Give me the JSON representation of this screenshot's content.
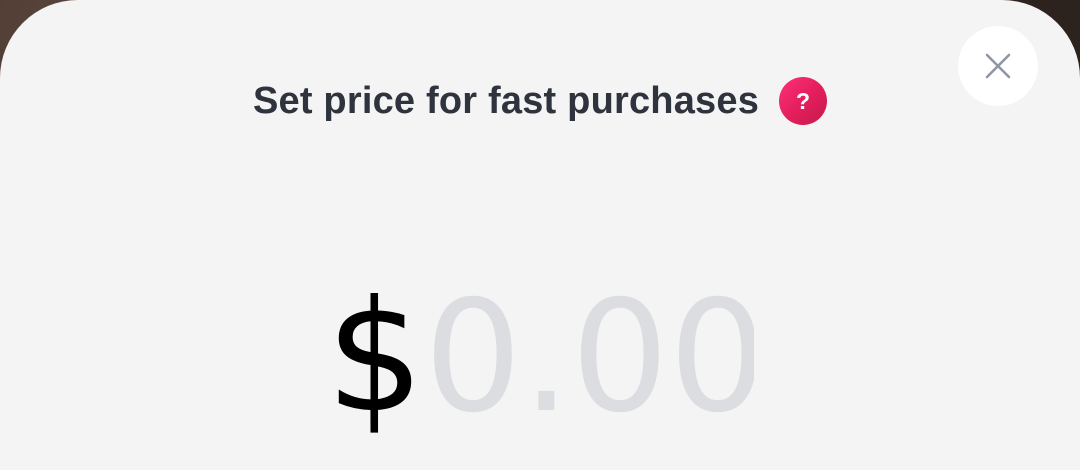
{
  "dialog": {
    "title": "Set price for fast purchases",
    "help_icon": "question-mark-icon",
    "help_glyph": "?",
    "close_icon": "close-icon"
  },
  "price": {
    "currency_symbol": "$",
    "value": "",
    "placeholder": "0.00"
  },
  "colors": {
    "sheet_background": "#f4f4f4",
    "title_text": "#2e333d",
    "help_gradient_start": "#ff2f7a",
    "help_gradient_end": "#c41a4c",
    "placeholder_text": "#dcdde0",
    "close_icon": "#8f96a6"
  }
}
